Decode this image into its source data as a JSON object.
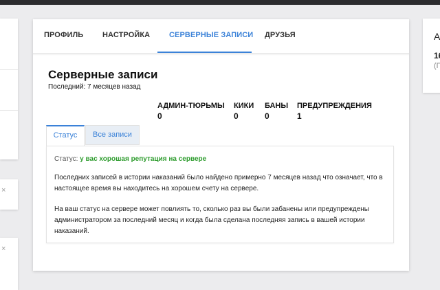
{
  "tabs": {
    "profile": "ПРОФИЛЬ",
    "settings": "НАСТРОЙКА",
    "server_records": "СЕРВЕРНЫЕ ЗАПИСИ",
    "friends": "ДРУЗЬЯ"
  },
  "header": {
    "title": "Серверные записи",
    "last": "Последний: 7 месяцев назад"
  },
  "stats": [
    {
      "label": "АДМИН-ТЮРЬМЫ",
      "value": "0"
    },
    {
      "label": "КИКИ",
      "value": "0"
    },
    {
      "label": "БАНЫ",
      "value": "0"
    },
    {
      "label": "ПРЕДУПРЕЖДЕНИЯ",
      "value": "1"
    }
  ],
  "subtabs": {
    "status": "Статус",
    "all_records": "Все записи"
  },
  "panel": {
    "status_label": "Статус:",
    "status_value": "у вас хорошая репутация на сервере",
    "paragraph1": "Последних записей в истории наказаний было найдено примерно 7 месяцев назад что означает, что в настоящее время вы находитесь на хорошем счету на сервере.",
    "paragraph2": "На ваш статус на сервере может повлиять то, сколько раз вы были забанены или предупреждены администратором за последний месяц и когда была сделана последняя запись в вашей истории наказаний."
  },
  "side_cards": {
    "close_symbol": "×",
    "right_title": "А",
    "right_value": "16",
    "right_note": "(П"
  },
  "colors": {
    "accent": "#3b82d8",
    "status_good": "#2e9c2e",
    "background": "#ececee"
  }
}
